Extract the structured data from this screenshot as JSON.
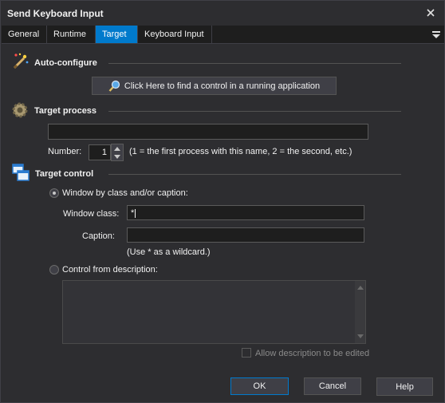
{
  "window": {
    "title": "Send Keyboard Input"
  },
  "tabs": [
    {
      "label": "General"
    },
    {
      "label": "Runtime"
    },
    {
      "label": "Target"
    },
    {
      "label": "Keyboard Input"
    }
  ],
  "auto_configure": {
    "title": "Auto-configure",
    "find_button": "Click Here to find a control in a running application"
  },
  "target_process": {
    "title": "Target process",
    "process_name_value": "",
    "number_label": "Number:",
    "number_value": "1",
    "number_hint": "(1 = the first process with this name, 2 = the second, etc.)"
  },
  "target_control": {
    "title": "Target control",
    "radio_class_label": "Window by class and/or caption:",
    "window_class_label": "Window class:",
    "window_class_value": "*",
    "caption_label": "Caption:",
    "caption_value": "",
    "wildcard_hint": "(Use * as a wildcard.)",
    "radio_description_label": "Control from description:",
    "allow_edit_label": "Allow description to be edited"
  },
  "footer": {
    "ok": "OK",
    "cancel": "Cancel",
    "help": "Help"
  },
  "colors": {
    "accent": "#007acc",
    "background": "#2d2d30",
    "input_bg": "#1e1e1e"
  }
}
